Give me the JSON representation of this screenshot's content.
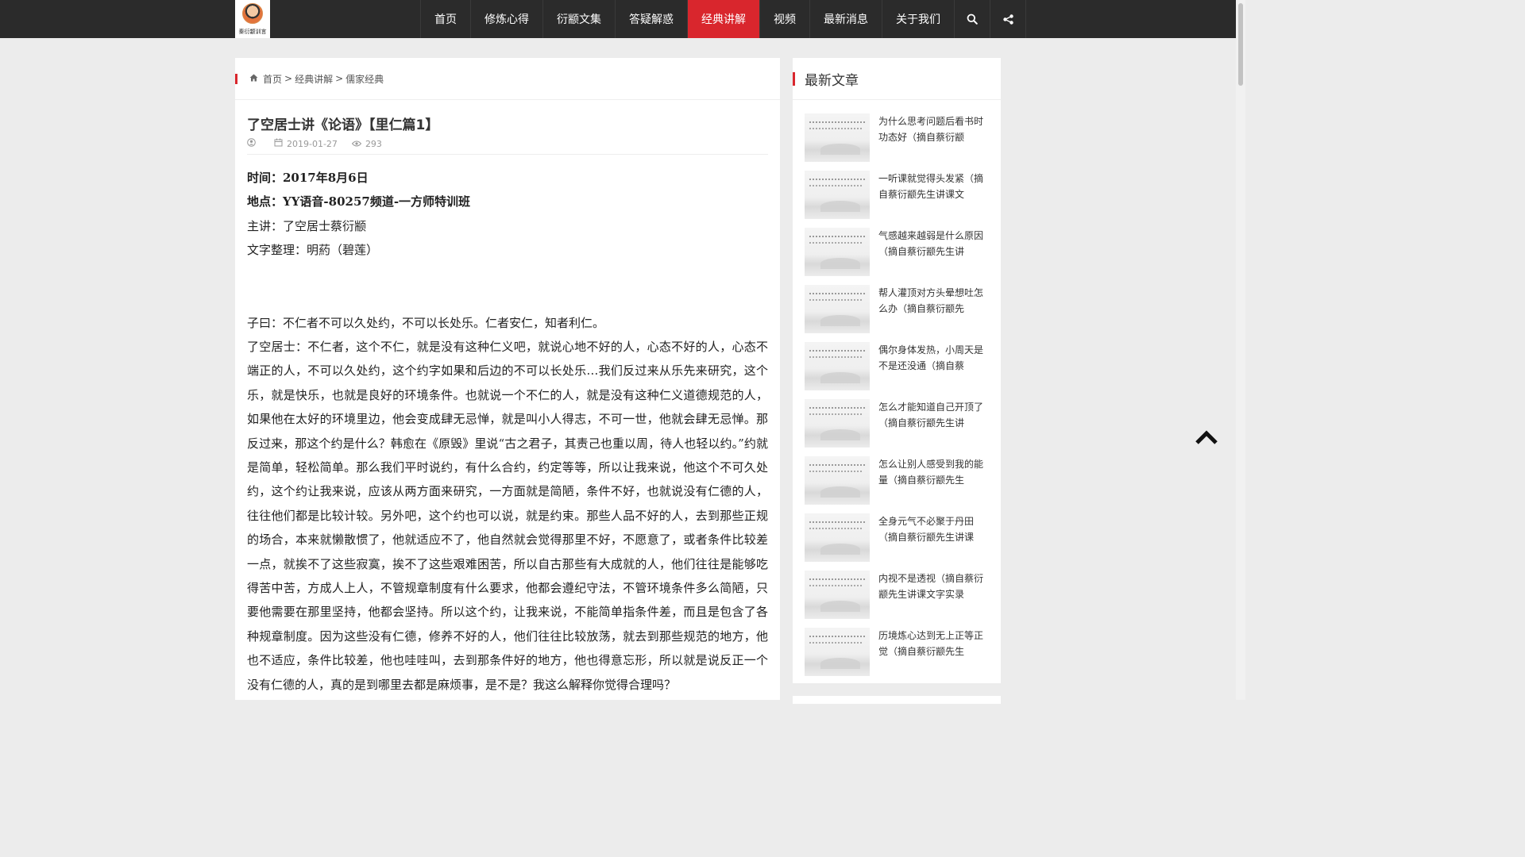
{
  "brand": {
    "logo_text": "秦衍颛训言"
  },
  "nav": {
    "items": [
      {
        "label": "首页",
        "active": false
      },
      {
        "label": "修炼心得",
        "active": false
      },
      {
        "label": "衍颛文集",
        "active": false
      },
      {
        "label": "答疑解惑",
        "active": false
      },
      {
        "label": "经典讲解",
        "active": true
      },
      {
        "label": "视频",
        "active": false
      },
      {
        "label": "最新消息",
        "active": false
      },
      {
        "label": "关于我们",
        "active": false
      }
    ],
    "search_icon": "search-icon",
    "share_icon": "share-icon",
    "active_color": "#d9262d"
  },
  "breadcrumb": {
    "home": "首页",
    "section": "经典讲解",
    "current": "儒家经典",
    "sep": ">"
  },
  "article": {
    "title": "了空居士讲《论语》【里仁篇1】",
    "date": "2019-01-27",
    "views": "293",
    "info": [
      "时间：2017年8月6日",
      "地点：YY语音-80257频道-一方师特训班",
      "主讲：了空居士蔡衍颛",
      "文字整理：明葯（碧莲）"
    ],
    "quote": "子曰：不仁者不可以久处约，不可以长处乐。仁者安仁，知者利仁。",
    "commentary": "了空居士：不仁者，这个不仁，就是没有这种仁义吧，就说心地不好的人，心态不好的人，心态不端正的人，不可以久处约，这个约字如果和后边的不可以长处乐…我们反过来从乐先来研究，这个乐，就是快乐，也就是良好的环境条件。也就说一个不仁的人，就是没有这种仁义道德规范的人，如果他在太好的环境里边，他会变成肆无忌惮，就是叫小人得志，不可一世，他就会肆无忌惮。那反过来，那这个约是什么？韩愈在《原毁》里说“古之君子，其责己也重以周，待人也轻以约。”约就是简单，轻松简单。那么我们平时说约，有什么合约，约定等等，所以让我来说，他这个不可久处约，这个约让我来说，应该从两方面来研究，一方面就是简陋，条件不好，也就说没有仁德的人，往往他们都是比较计较。另外吧，这个约也可以说，就是约束。那些人品不好的人，去到那些正规的场合，本来就懒散惯了，他就适应不了，他自然就会觉得那里不好，不愿意了，或者条件比较差一点，就挨不了这些寂寞，挨不了这些艰难困苦，所以自古那些有大成就的人，他们往往是能够吃得苦中苦，方成人上人，不管规章制度有什么要求，他都会遵纪守法，不管环境条件多么简陋，只要他需要在那里坚持，他都会坚持。所以这个约，让我来说，不能简单指条件差，而且是包含了各种规章制度。因为这些没有仁德，修养不好的人，他们往往比较放荡，就去到那些规范的地方，他也不适应，条件比较差，他也哇哇叫，去到那条件好的地方，他也得意忘形，所以就是说反正一个没有仁德的人，真的是到哪里去都是麻烦事，是不是？我这么解释你觉得合理吗？"
  },
  "sidebar": {
    "heading": "最新文章",
    "items": [
      {
        "title": "为什么思考问题后看书时功态好（摘自蔡衍颛"
      },
      {
        "title": "一听课就觉得头发紧（摘自蔡衍颛先生讲课文"
      },
      {
        "title": "气感越来越弱是什么原因（摘自蔡衍颛先生讲"
      },
      {
        "title": "帮人灌顶对方头晕想吐怎么办（摘自蔡衍颛先"
      },
      {
        "title": "偶尔身体发热，小周天是不是还没通（摘自蔡"
      },
      {
        "title": "怎么才能知道自己开顶了（摘自蔡衍颛先生讲"
      },
      {
        "title": "怎么让别人感受到我的能量（摘自蔡衍颛先生"
      },
      {
        "title": "全身元气不必聚于丹田（摘自蔡衍颛先生讲课"
      },
      {
        "title": "内视不是透视（摘自蔡衍颛先生讲课文字实录"
      },
      {
        "title": "历境炼心达到无上正等正觉（摘自蔡衍颛先生"
      }
    ]
  }
}
